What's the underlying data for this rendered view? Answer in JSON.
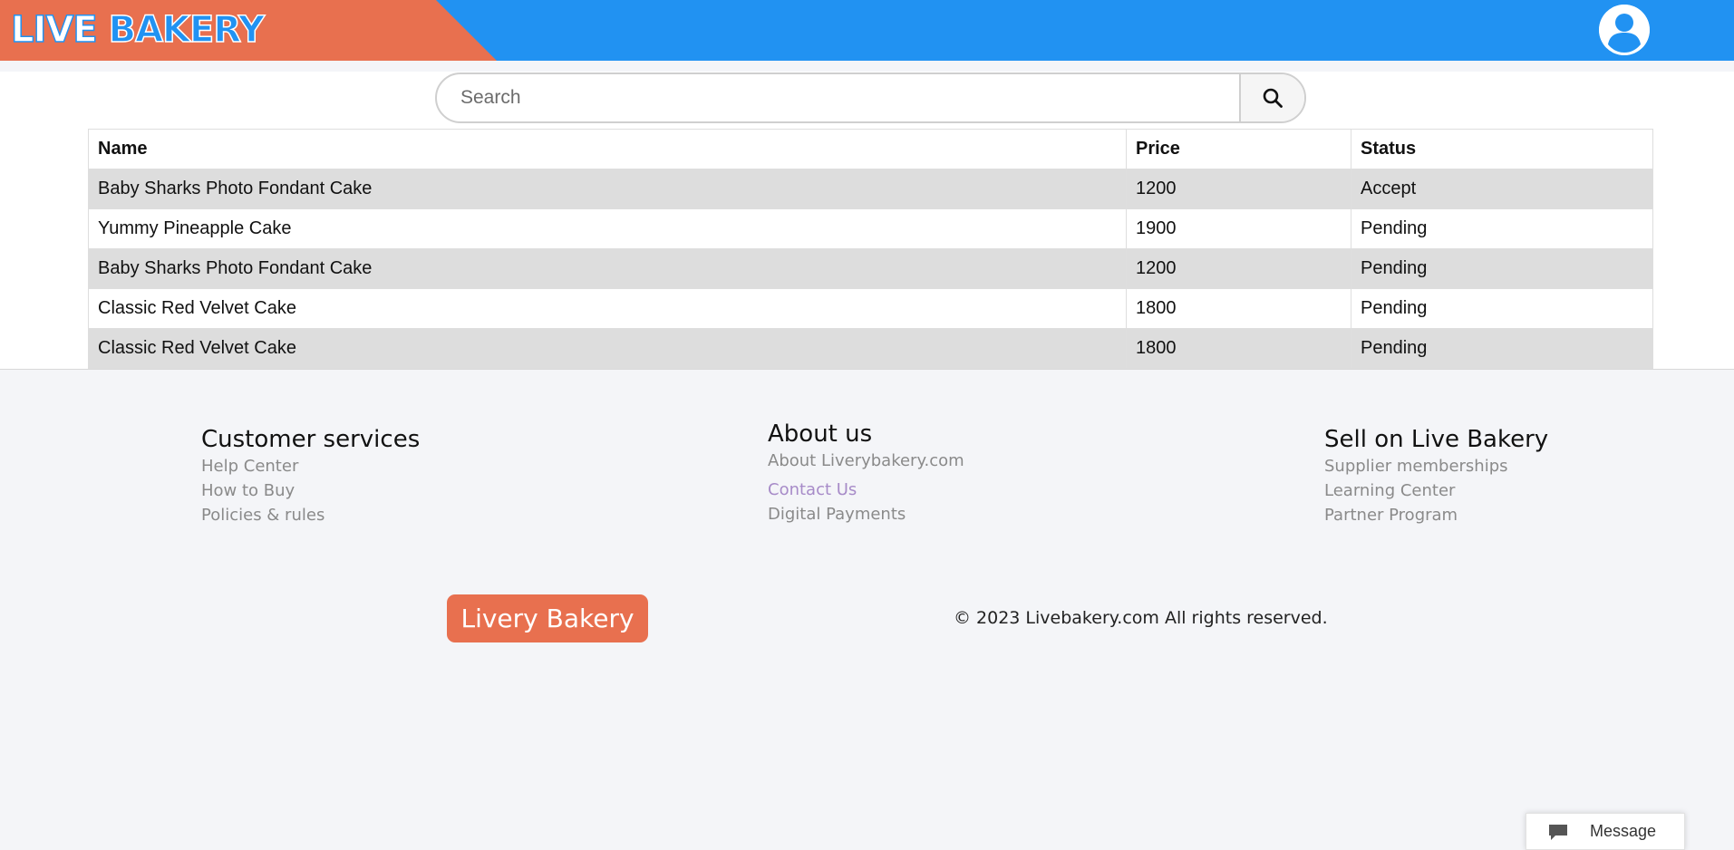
{
  "header": {
    "logo_word1": "LIVE",
    "logo_word2": "BAKERY",
    "colors": {
      "primary_blue": "#2192f2",
      "brand_orange": "#e8704f"
    },
    "avatar_icon": "user-circle-icon"
  },
  "search": {
    "placeholder": "Search",
    "icon": "search-icon"
  },
  "table": {
    "headers": [
      "Name",
      "Price",
      "Status"
    ],
    "rows": [
      {
        "name": "Baby Sharks Photo Fondant Cake",
        "price": "1200",
        "status": "Accept"
      },
      {
        "name": "Yummy Pineapple Cake",
        "price": "1900",
        "status": "Pending"
      },
      {
        "name": "Baby Sharks Photo Fondant Cake",
        "price": "1200",
        "status": "Pending"
      },
      {
        "name": "Classic Red Velvet Cake",
        "price": "1800",
        "status": "Pending"
      },
      {
        "name": "Classic Red Velvet Cake",
        "price": "1800",
        "status": "Pending"
      }
    ]
  },
  "footer": {
    "customer_services": {
      "title": "Customer services",
      "links": [
        "Help Center",
        "How to Buy",
        "Policies & rules"
      ]
    },
    "about": {
      "title": "About us",
      "links": [
        "About Liverybakery.com",
        "Contact Us",
        "Digital Payments"
      ]
    },
    "sell": {
      "title": "Sell on Live Bakery",
      "links": [
        "Supplier memberships",
        "Learning Center",
        "Partner Program"
      ]
    },
    "brand_button": "Livery Bakery",
    "copyright": "© 2023 Livebakery.com All rights reserved."
  },
  "message_widget": {
    "label": "Message",
    "icon": "chat-bubble-icon"
  }
}
